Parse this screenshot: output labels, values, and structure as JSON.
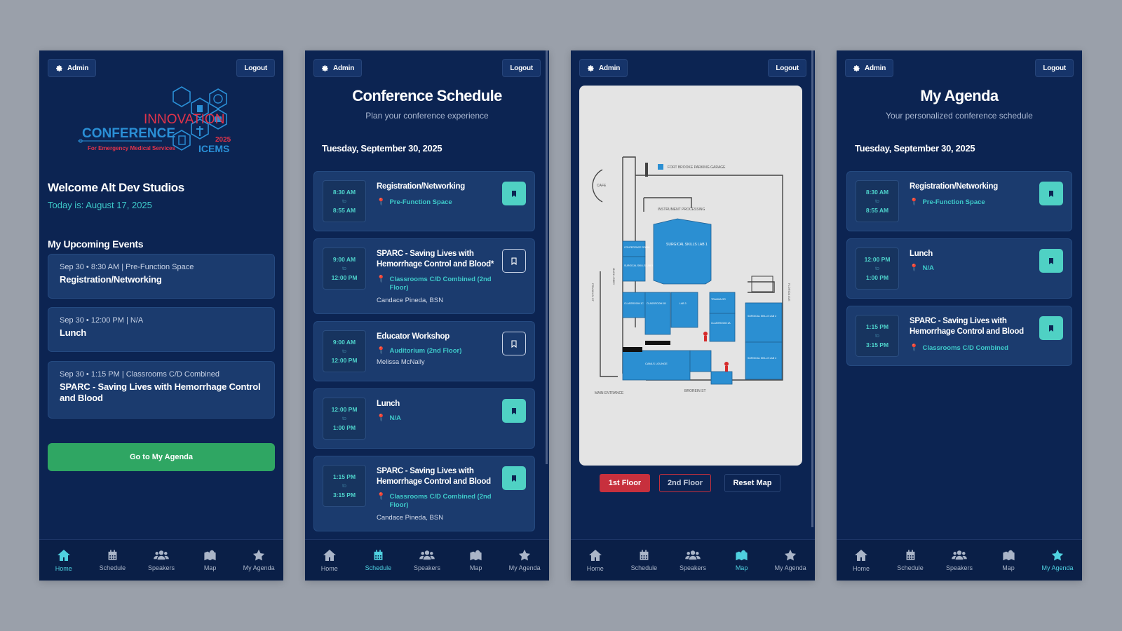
{
  "common": {
    "admin": "Admin",
    "logout": "Logout"
  },
  "nav": [
    {
      "label": "Home",
      "icon": "home-icon"
    },
    {
      "label": "Schedule",
      "icon": "calendar-icon"
    },
    {
      "label": "Speakers",
      "icon": "users-icon"
    },
    {
      "label": "Map",
      "icon": "map-icon"
    },
    {
      "label": "My Agenda",
      "icon": "star-icon"
    }
  ],
  "home": {
    "logo": {
      "line1": "INNOVATION",
      "line2": "CONFERENCE",
      "tagline": "For Emergency Medical Services",
      "year": "2025",
      "acronym": "ICEMS"
    },
    "welcome": "Welcome Alt Dev Studios",
    "today": "Today is: August 17, 2025",
    "section_title": "My Upcoming Events",
    "events": [
      {
        "meta": "Sep 30 • 8:30 AM | Pre-Function Space",
        "title": "Registration/Networking"
      },
      {
        "meta": "Sep 30 • 12:00 PM | N/A",
        "title": "Lunch"
      },
      {
        "meta": "Sep 30 • 1:15 PM | Classrooms C/D Combined",
        "title": "SPARC - Saving Lives with Hemorrhage Control and Blood"
      }
    ],
    "agenda_button": "Go to My Agenda"
  },
  "schedule": {
    "title": "Conference Schedule",
    "subtitle": "Plan your conference experience",
    "date": "Tuesday, September 30, 2025",
    "events": [
      {
        "start": "8:30 AM",
        "to": "to",
        "end": "8:55 AM",
        "title": "Registration/Networking",
        "location": "Pre-Function Space",
        "speaker": "",
        "bookmarked": true
      },
      {
        "start": "9:00 AM",
        "to": "to",
        "end": "12:00 PM",
        "title": "SPARC - Saving Lives with Hemorrhage Control and Blood*",
        "location": "Classrooms C/D Combined (2nd Floor)",
        "speaker": "Candace Pineda, BSN",
        "bookmarked": false
      },
      {
        "start": "9:00 AM",
        "to": "to",
        "end": "12:00 PM",
        "title": "Educator Workshop",
        "location": "Auditorium (2nd Floor)",
        "speaker": "Melissa McNally",
        "bookmarked": false
      },
      {
        "start": "12:00 PM",
        "to": "to",
        "end": "1:00 PM",
        "title": "Lunch",
        "location": "N/A",
        "speaker": "",
        "bookmarked": true
      },
      {
        "start": "1:15 PM",
        "to": "to",
        "end": "3:15 PM",
        "title": "SPARC - Saving Lives with Hemorrhage Control and Blood",
        "location": "Classrooms C/D Combined (2nd Floor)",
        "speaker": "Candace Pineda, BSN",
        "bookmarked": true
      }
    ]
  },
  "map": {
    "floor1": "1st Floor",
    "floor2": "2nd Floor",
    "reset": "Reset Map",
    "labels": {
      "garage": "FORT BROOKE PARKING GARAGE",
      "cafe": "CAFE",
      "instrument": "INSTRUMENT PROCESSING",
      "lab1": "SURGICAL SKILLS LAB 1",
      "conf": "CONFERENCE ROOM",
      "lab5": "SURGICAL SKILLS LAB 5",
      "main_lobby": "MAIN LOBBY",
      "franklin": "FRANKLIN ST",
      "florida": "FLORIDA AVE",
      "classroom_1c": "CLASSROOM 1C",
      "classroom_1b": "CLASSROOM 1B",
      "lab3": "LAB 3",
      "trauma": "TRAUMA OR",
      "classroom_1a": "CLASSROOM 1A",
      "lab2": "SURGICAL SKILLS LAB 2",
      "lab4": "SURGICAL SKILLS LAB 4",
      "lounge": "CAMLS LOUNGE",
      "main_entrance": "MAIN ENTRANCE",
      "brorein": "BROREIN ST"
    }
  },
  "agenda": {
    "title": "My Agenda",
    "subtitle": "Your personalized conference schedule",
    "date": "Tuesday, September 30, 2025",
    "events": [
      {
        "start": "8:30 AM",
        "to": "to",
        "end": "8:55 AM",
        "title": "Registration/Networking",
        "location": "Pre-Function Space"
      },
      {
        "start": "12:00 PM",
        "to": "to",
        "end": "1:00 PM",
        "title": "Lunch",
        "location": "N/A"
      },
      {
        "start": "1:15 PM",
        "to": "to",
        "end": "3:15 PM",
        "title": "SPARC - Saving Lives with Hemorrhage Control and Blood",
        "location": "Classrooms C/D Combined"
      }
    ]
  },
  "colors": {
    "bg": "#9aa0aa",
    "panel": "#0c2452",
    "card": "#1b3b6e",
    "accent": "#4fd1c4",
    "green": "#2fa663",
    "red": "#c7303d"
  }
}
